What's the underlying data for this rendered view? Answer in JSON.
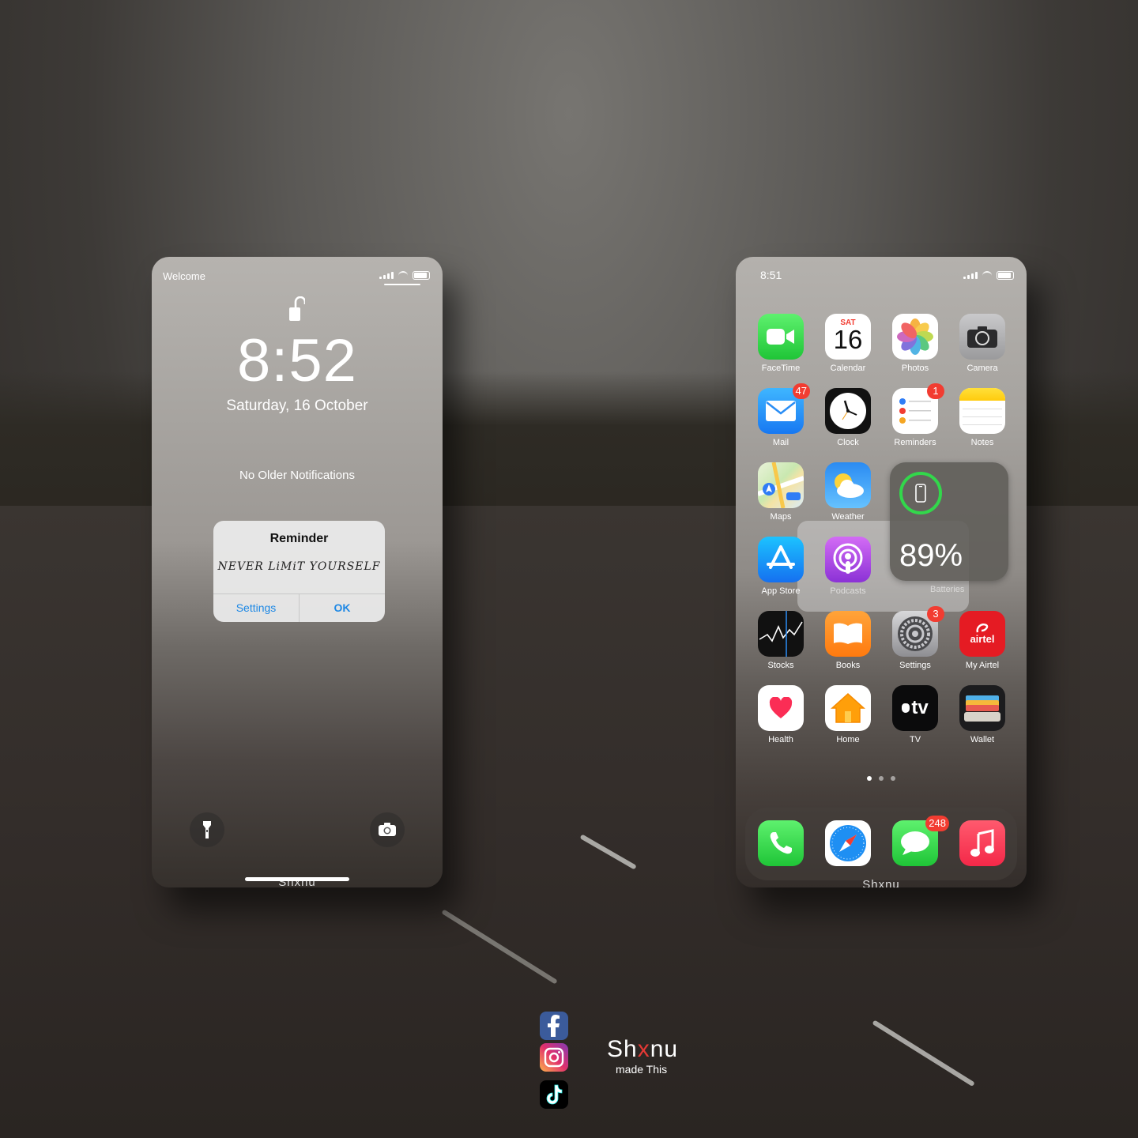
{
  "lock_screen": {
    "carrier": "Welcome",
    "time": "8:52",
    "date": "Saturday, 16 October",
    "no_notifications": "No Older Notifications",
    "alert": {
      "title": "Reminder",
      "message": "NEVER LiMiT YOURSELF",
      "settings_label": "Settings",
      "ok_label": "OK"
    },
    "watermark": "Shxnu"
  },
  "home_screen": {
    "time": "8:51",
    "calendar_day": "SAT",
    "calendar_date": "16",
    "apps": [
      {
        "label": "FaceTime"
      },
      {
        "label": "Calendar"
      },
      {
        "label": "Photos"
      },
      {
        "label": "Camera"
      },
      {
        "label": "Mail",
        "badge": "47"
      },
      {
        "label": "Clock"
      },
      {
        "label": "Reminders",
        "badge": "1"
      },
      {
        "label": "Notes"
      },
      {
        "label": "Maps"
      },
      {
        "label": "Weather"
      },
      {
        "label": "App Store"
      },
      {
        "label": "Podcasts"
      },
      {
        "label": "Stocks"
      },
      {
        "label": "Books"
      },
      {
        "label": "Settings",
        "badge": "3"
      },
      {
        "label": "My Airtel"
      },
      {
        "label": "Health"
      },
      {
        "label": "Home"
      },
      {
        "label": "TV"
      },
      {
        "label": "Wallet"
      }
    ],
    "battery_widget": {
      "percent": "89%",
      "label": "Batteries"
    },
    "dock": [
      {
        "name": "Phone"
      },
      {
        "name": "Safari"
      },
      {
        "name": "Messages",
        "badge": "248"
      },
      {
        "name": "Music"
      }
    ],
    "page_dots": 3,
    "active_page": 1,
    "watermark": "Shxnu",
    "tv_glyph": "tv",
    "airtel_text": "airtel"
  },
  "credits": {
    "brand_prefix": "Sh",
    "brand_x": "x",
    "brand_suffix": "nu",
    "made_this": "made This"
  },
  "colors": {
    "badge": "#f23c31",
    "alert_button": "#1e88e5",
    "battery_ring": "#32d74b"
  }
}
